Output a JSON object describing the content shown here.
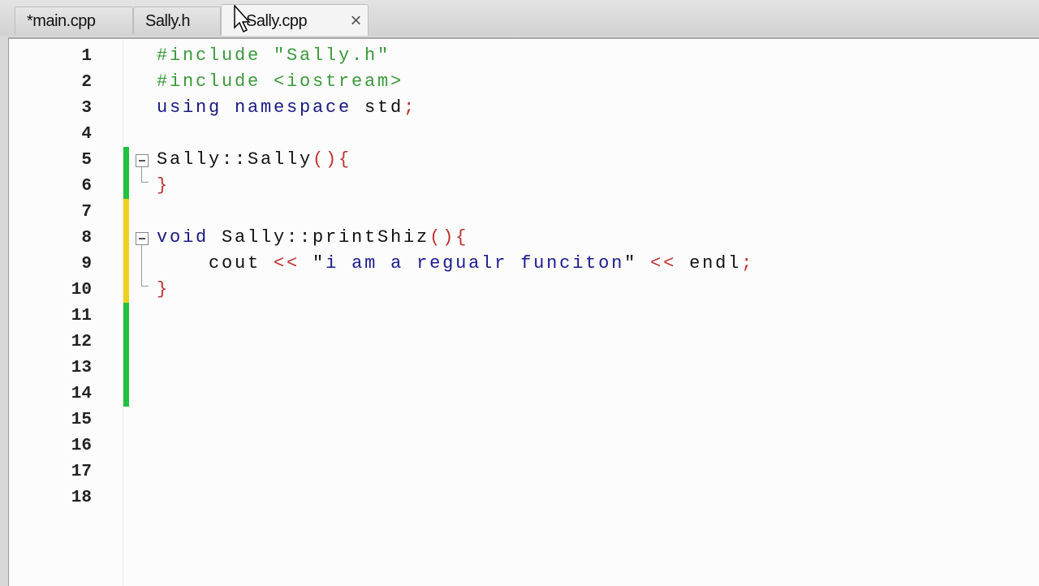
{
  "tabs": [
    {
      "label": "*main.cpp",
      "active": false
    },
    {
      "label": "Sally.h",
      "active": false
    },
    {
      "label": "Sally.cpp",
      "active": true,
      "close": "×"
    }
  ],
  "colors": {
    "modified_saved": "#22c040",
    "modified_unsaved": "#f0d020"
  },
  "lines": [
    {
      "n": "1",
      "tokens": [
        [
          "#include \"Sally.h\"",
          "pp"
        ]
      ]
    },
    {
      "n": "2",
      "tokens": [
        [
          "#include <iostream>",
          "pp"
        ]
      ]
    },
    {
      "n": "3",
      "tokens": [
        [
          "using namespace ",
          "kw"
        ],
        [
          "std",
          "id"
        ],
        [
          ";",
          "op"
        ]
      ]
    },
    {
      "n": "4",
      "tokens": []
    },
    {
      "n": "5",
      "tokens": [
        [
          "Sally::Sally",
          "id"
        ],
        [
          "(){",
          "op"
        ]
      ]
    },
    {
      "n": "6",
      "tokens": [
        [
          "}",
          "op"
        ]
      ]
    },
    {
      "n": "7",
      "tokens": []
    },
    {
      "n": "8",
      "tokens": [
        [
          "void ",
          "kw"
        ],
        [
          "Sally::printShiz",
          "id"
        ],
        [
          "(){",
          "op"
        ]
      ]
    },
    {
      "n": "9",
      "tokens": [
        [
          "    cout ",
          "id"
        ],
        [
          "<<",
          "op"
        ],
        [
          " \"",
          "id"
        ],
        [
          "i am a regualr funciton",
          "str"
        ],
        [
          "\" ",
          "id"
        ],
        [
          "<<",
          "op"
        ],
        [
          " endl",
          "id"
        ],
        [
          ";",
          "op"
        ]
      ]
    },
    {
      "n": "10",
      "tokens": [
        [
          "}",
          "op"
        ]
      ]
    },
    {
      "n": "11",
      "tokens": []
    },
    {
      "n": "12",
      "tokens": []
    },
    {
      "n": "13",
      "tokens": []
    },
    {
      "n": "14",
      "tokens": []
    },
    {
      "n": "15",
      "tokens": []
    },
    {
      "n": "16",
      "tokens": []
    },
    {
      "n": "17",
      "tokens": []
    },
    {
      "n": "18",
      "tokens": []
    }
  ]
}
